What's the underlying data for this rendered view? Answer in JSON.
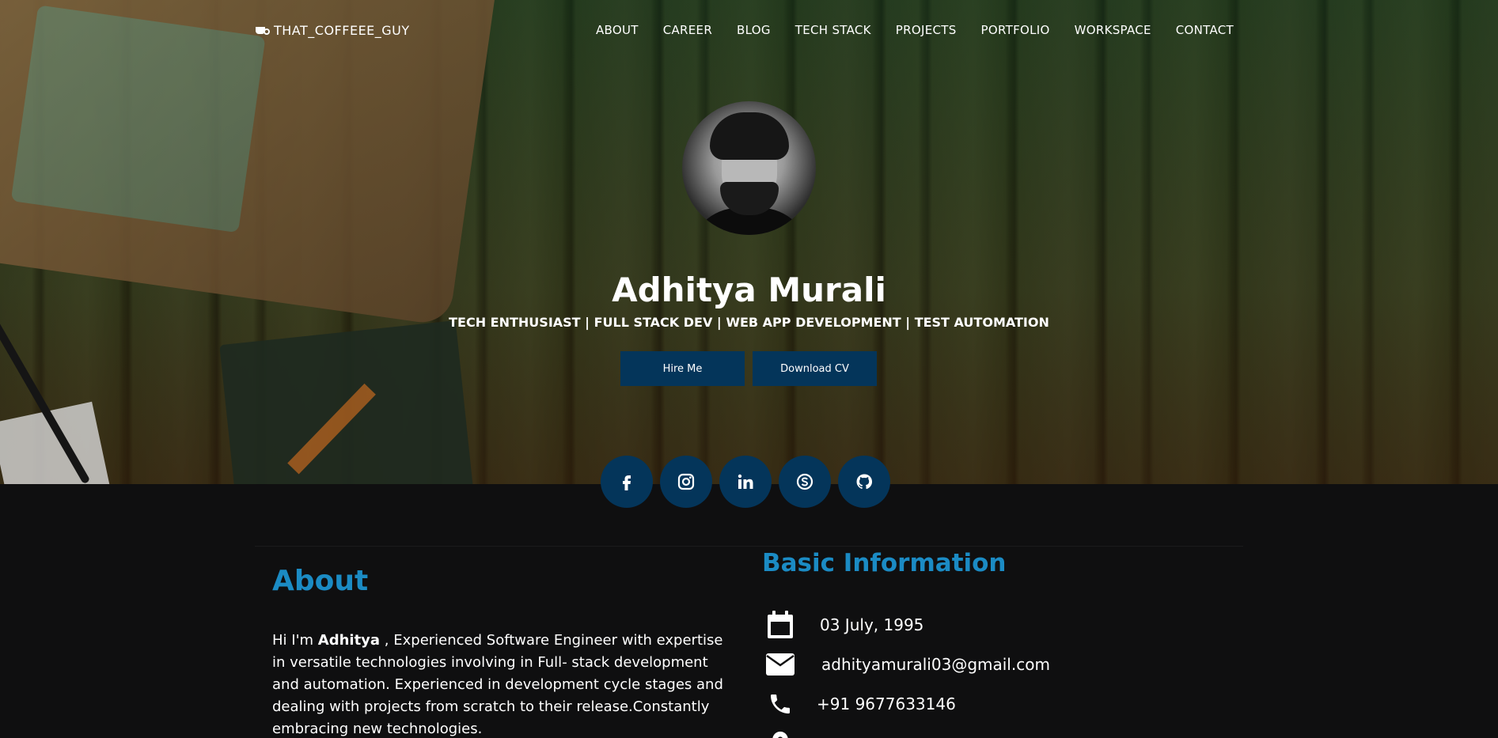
{
  "brand": {
    "logo_text": "THAT_COFFEEE_GUY",
    "icon": "coffee-cup-icon"
  },
  "nav": {
    "items": [
      {
        "label": "ABOUT"
      },
      {
        "label": "CAREER"
      },
      {
        "label": "BLOG"
      },
      {
        "label": "TECH STACK"
      },
      {
        "label": "PROJECTS"
      },
      {
        "label": "PORTFOLIO"
      },
      {
        "label": "WORKSPACE"
      },
      {
        "label": "CONTACT"
      }
    ]
  },
  "hero": {
    "name": "Adhitya Murali",
    "tagline": "TECH ENTHUSIAST | FULL STACK DEV | WEB APP DEVELOPMENT | TEST AUTOMATION",
    "hire_label": "Hire Me",
    "cv_label": "Download CV"
  },
  "socials": [
    {
      "icon": "facebook-icon"
    },
    {
      "icon": "instagram-icon"
    },
    {
      "icon": "linkedin-icon"
    },
    {
      "icon": "skype-icon"
    },
    {
      "icon": "github-icon"
    }
  ],
  "about": {
    "title": "About",
    "intro": "Hi I'm ",
    "name_bold": "Adhitya",
    "body": " , Experienced Software Engineer with expertise in versatile technologies involving in Full- stack development and automation. Experienced in development cycle stages and dealing with projects from scratch to their release.Constantly embracing new technologies."
  },
  "basic_info": {
    "title": "Basic Information",
    "dob": "03 July, 1995",
    "email": "adhityamurali03@gmail.com",
    "phone": "+91 9677633146"
  },
  "colors": {
    "accent_blue": "#1b8bc4",
    "button_navy": "#04355a",
    "background": "#0f0f10"
  }
}
